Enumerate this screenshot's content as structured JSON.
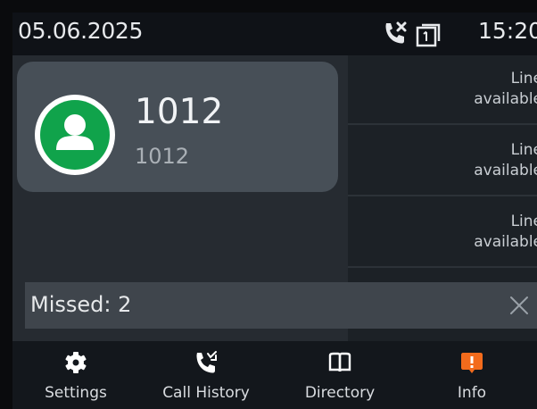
{
  "status_bar": {
    "date": "05.06.2025",
    "time": "15:20",
    "icons": [
      "missed-call-icon",
      "line-status-icon"
    ]
  },
  "account": {
    "name": "1012",
    "number": "1012",
    "status_color": "#10a34b"
  },
  "lines": [
    {
      "label": "Line",
      "status": "available"
    },
    {
      "label": "Line",
      "status": "available"
    },
    {
      "label": "Line",
      "status": "available"
    }
  ],
  "missed": {
    "text": "Missed: 2"
  },
  "nav": [
    {
      "label": "Settings",
      "icon": "gear-icon"
    },
    {
      "label": "Call History",
      "icon": "call-history-icon"
    },
    {
      "label": "Directory",
      "icon": "directory-book-icon"
    },
    {
      "label": "Info",
      "icon": "info-icon",
      "accent": "#f36b1c"
    }
  ],
  "colors": {
    "background": "#262b31",
    "status_bar": "#0f1217",
    "card": "#474f57",
    "nav_bar": "#13171c",
    "accent": "#f36b1c"
  }
}
